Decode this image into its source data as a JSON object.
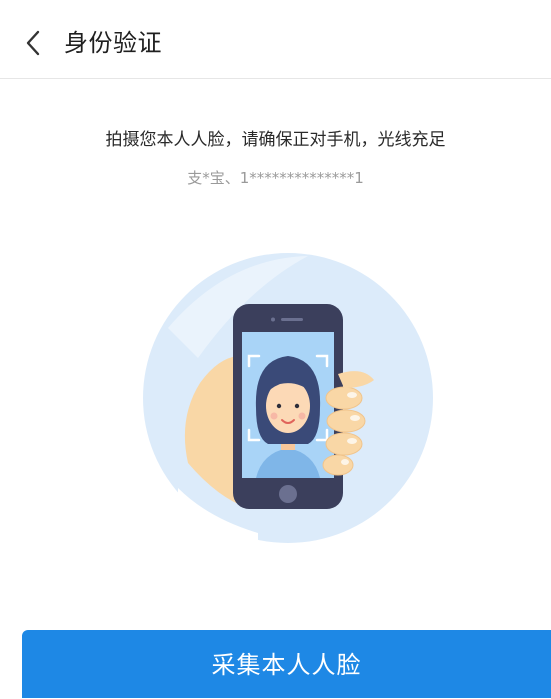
{
  "header": {
    "back_icon": "chevron-left-icon",
    "title": "身份验证"
  },
  "main": {
    "instruction": "拍摄您本人人脸，请确保正对手机，光线充足",
    "account": "支*宝、1**************1",
    "illustration_icon": "face-capture-illustration"
  },
  "footer": {
    "primary_button_label": "采集本人人脸"
  },
  "colors": {
    "accent": "#1e88e5",
    "circle": "#dcebfa",
    "phone_body": "#3b3f5c",
    "screen": "#a9d4f7"
  }
}
